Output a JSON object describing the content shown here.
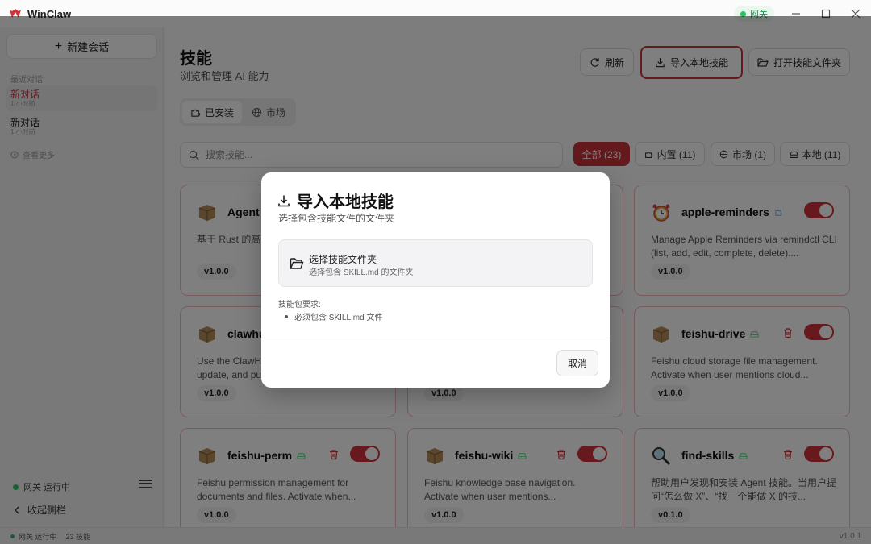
{
  "app": {
    "title": "WinClaw",
    "gateway_pill": "网关"
  },
  "sidebar": {
    "new_chat": "新建会话",
    "recent_label": "最近对话",
    "conversations": [
      {
        "title": "新对话",
        "time": "1 小时前"
      },
      {
        "title": "新对话",
        "time": "1 小时前"
      }
    ],
    "see_more": "查看更多",
    "status": "网关 运行中",
    "collapse": "收起侧栏"
  },
  "header": {
    "title": "技能",
    "subtitle": "浏览和管理 AI 能力",
    "refresh": "刷新",
    "import_local": "导入本地技能",
    "open_folder": "打开技能文件夹"
  },
  "tabs": {
    "installed": "已安装",
    "market": "市场"
  },
  "search": {
    "placeholder": "搜索技能..."
  },
  "filters": {
    "all": "全部 (23)",
    "builtin": "内置 (11)",
    "market": "市场 (1)",
    "local": "本地 (11)"
  },
  "cards": [
    {
      "name": "Agent",
      "desc": "基于 Rust 的高性能... (支持 Node.js",
      "version": "v1.0.0"
    },
    {
      "name": "apple-reminders",
      "desc": "Manage Apple Reminders via remindctl CLI (list, add, edit, complete, delete)....",
      "version": "v1.0.0"
    },
    {
      "name": "clawhu",
      "desc": "Use the ClawHub CLI to search, install, update, and publish...",
      "version": "v1.0.0"
    },
    {
      "name": "",
      "desc": "",
      "version": "v1.0.0"
    },
    {
      "name": "feishu-drive",
      "desc": "Feishu cloud storage file management. Activate when user mentions cloud...",
      "version": "v1.0.0"
    },
    {
      "name": "feishu-perm",
      "desc": "Feishu permission management for documents and files. Activate when...",
      "version": "v1.0.0"
    },
    {
      "name": "feishu-wiki",
      "desc": "Feishu knowledge base navigation. Activate when user mentions...",
      "version": "v1.0.0"
    },
    {
      "name": "find-skills",
      "desc": "帮助用户发现和安装 Agent 技能。当用户提问“怎么做 X”、“找一个能做 X 的技...",
      "version": "v0.1.0"
    }
  ],
  "footer": {
    "status": "网关 运行中",
    "skills": "23 技能",
    "version": "v1.0.1"
  },
  "modal": {
    "title": "导入本地技能",
    "subtitle": "选择包含技能文件的文件夹",
    "pick_title": "选择技能文件夹",
    "pick_sub": "选择包含 SKILL.md 的文件夹",
    "req_label": "技能包要求:",
    "req_item": "必须包含 SKILL.md 文件",
    "cancel": "取消"
  },
  "colors": {
    "accent": "#c8323a",
    "status_green": "#22c55e"
  }
}
